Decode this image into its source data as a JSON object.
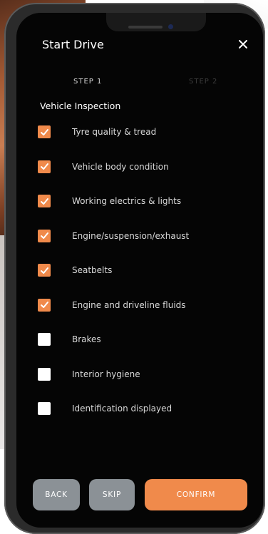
{
  "header": {
    "title": "Start Drive"
  },
  "steps": {
    "step1": "STEP 1",
    "step2": "STEP 2"
  },
  "section": {
    "title": "Vehicle Inspection"
  },
  "checklist": [
    {
      "label": "Tyre quality & tread",
      "checked": true
    },
    {
      "label": "Vehicle body condition",
      "checked": true
    },
    {
      "label": "Working electrics & lights",
      "checked": true
    },
    {
      "label": "Engine/suspension/exhaust",
      "checked": true
    },
    {
      "label": "Seatbelts",
      "checked": true
    },
    {
      "label": "Engine and driveline fluids",
      "checked": true
    },
    {
      "label": "Brakes",
      "checked": false
    },
    {
      "label": "Interior hygiene",
      "checked": false
    },
    {
      "label": "Identification displayed",
      "checked": false
    }
  ],
  "buttons": {
    "back": "BACK",
    "skip": "SKIP",
    "confirm": "CONFIRM"
  },
  "colors": {
    "accent": "#f08a4b",
    "background": "#050505",
    "secondary_button": "#8b9196"
  },
  "icons": {
    "close": "close-icon",
    "check": "check-icon"
  }
}
